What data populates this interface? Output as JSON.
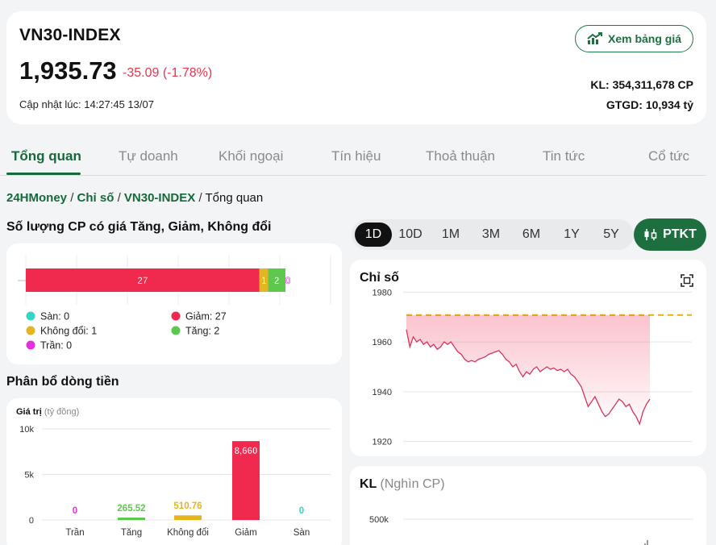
{
  "header": {
    "index_name": "VN30-INDEX",
    "price": "1,935.73",
    "change": "-35.09 (-1.78%)",
    "updated": "Cập nhật lúc: 14:27:45 13/07",
    "board_button": "Xem bảng giá",
    "volume": "KL: 354,311,678 CP",
    "value": "GTGD: 10,934 tỷ",
    "down_color": "#e5364d",
    "brand_color": "#1e6f3f"
  },
  "tabs": [
    "Tổng quan",
    "Tự doanh",
    "Khối ngoại",
    "Tín hiệu",
    "Thoả thuận",
    "Tin tức",
    "Cổ tức"
  ],
  "active_tab": 0,
  "breadcrumb": {
    "items": [
      "24HMoney",
      "Chỉ số",
      "VN30-INDEX"
    ],
    "current": "Tổng quan",
    "separator": "/"
  },
  "stock_count": {
    "title": "Số lượng CP có giá Tăng, Giảm, Không đổi",
    "legend": [
      {
        "label": "Sàn: 0",
        "color": "#33d6c0"
      },
      {
        "label": "Giảm: 27",
        "color": "#f0294f"
      },
      {
        "label": "Không đổi: 1",
        "color": "#e3b521"
      },
      {
        "label": "Tăng: 2",
        "color": "#5cc94e"
      },
      {
        "label": "Trần: 0",
        "color": "#e62ee0"
      }
    ]
  },
  "money_flow": {
    "title": "Phân bổ dòng tiền",
    "axis_title": "Giá trị",
    "axis_unit": "(tỷ đồng)"
  },
  "periods": [
    "1D",
    "10D",
    "1M",
    "3M",
    "6M",
    "1Y",
    "5Y"
  ],
  "active_period": 0,
  "ptkt_button": "PTKT",
  "index_chart": {
    "title": "Chỉ số"
  },
  "volume_chart": {
    "title": "KL",
    "unit": "(Nghìn CP)"
  },
  "chart_data": [
    {
      "type": "bar",
      "orientation": "horizontal-stacked",
      "categories": [
        "Sàn",
        "Giảm",
        "Không đổi",
        "Tăng",
        "Trần"
      ],
      "values": [
        0,
        27,
        1,
        2,
        0
      ],
      "colors": [
        "#33d6c0",
        "#f0294f",
        "#e3b521",
        "#5cc94e",
        "#e62ee0"
      ],
      "title": "Số lượng CP có giá Tăng, Giảm, Không đổi",
      "legend": "bottom"
    },
    {
      "type": "bar",
      "categories": [
        "Trần",
        "Tăng",
        "Không đổi",
        "Giảm",
        "Sàn"
      ],
      "values": [
        0,
        265.52,
        510.76,
        8660,
        0
      ],
      "labels": [
        "0",
        "265.52",
        "510.76",
        "8,660",
        "0"
      ],
      "colors": [
        "#e62ee0",
        "#5cc94e",
        "#e3b521",
        "#f0294f",
        "#33d6c0"
      ],
      "title": "Phân bổ dòng tiền",
      "ylabel": "Giá trị (tỷ đồng)",
      "yticks": [
        0,
        5000,
        10000
      ],
      "ytick_labels": [
        "0",
        "5k",
        "10k"
      ],
      "ylim": [
        0,
        10000
      ],
      "grid": true
    },
    {
      "type": "area",
      "title": "Chỉ số",
      "reference_value": 1970.8,
      "ylim": [
        1915,
        1984
      ],
      "yticks": [
        1920,
        1940,
        1960,
        1980
      ],
      "x": [
        0,
        1,
        2,
        3,
        4,
        5,
        6,
        7,
        8,
        9,
        10,
        11,
        12,
        13,
        14,
        15,
        16,
        17,
        18,
        19,
        20,
        21,
        22,
        23,
        24,
        25,
        26,
        27,
        28,
        29,
        30,
        31,
        32,
        33,
        34,
        35,
        36,
        37,
        38,
        39,
        40,
        41,
        42,
        43,
        44,
        45,
        46,
        47,
        48,
        49,
        50,
        51,
        52,
        53,
        54,
        55,
        56,
        57,
        58,
        59,
        60,
        61,
        62,
        63,
        64,
        65,
        66,
        67,
        68,
        69,
        70,
        71
      ],
      "values": [
        1965,
        1958,
        1962,
        1960,
        1961,
        1959,
        1960,
        1958,
        1959,
        1957,
        1958,
        1960,
        1959,
        1960,
        1958,
        1956,
        1955,
        1953,
        1952,
        1952.5,
        1952,
        1953,
        1953.5,
        1954,
        1955,
        1955.5,
        1956,
        1956.5,
        1955,
        1953,
        1952,
        1950,
        1951,
        1948,
        1946,
        1948,
        1947,
        1949,
        1950,
        1948,
        1949,
        1950,
        1949,
        1949.5,
        1948.5,
        1949,
        1948,
        1949,
        1947,
        1946,
        1944,
        1942,
        1938,
        1934,
        1936,
        1938,
        1935,
        1932,
        1930,
        1931,
        1933,
        1935,
        1937,
        1936,
        1934,
        1935,
        1932,
        1930,
        1927,
        1932,
        1935,
        1937
      ],
      "grid": true
    },
    {
      "type": "bar",
      "title": "KL",
      "ylabel": "(Nghìn CP)",
      "yticks": [
        500000
      ],
      "ytick_labels": [
        "500k"
      ]
    }
  ]
}
